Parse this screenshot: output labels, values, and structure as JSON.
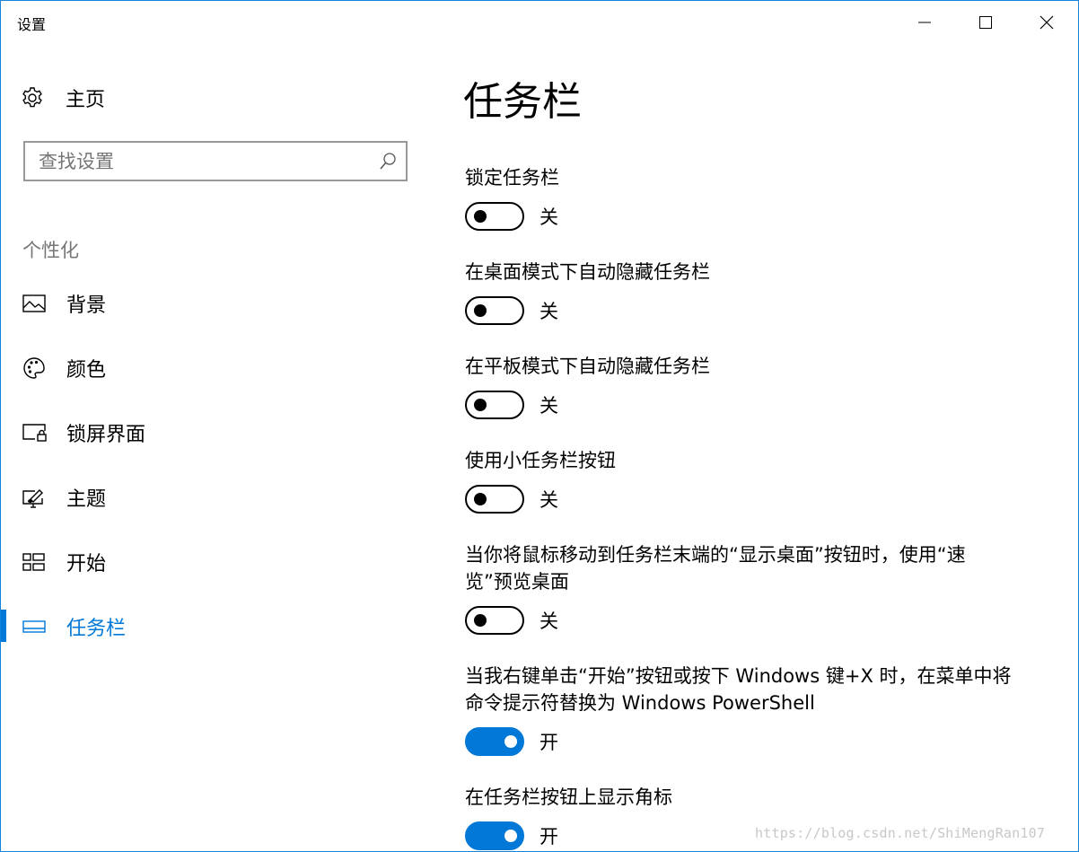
{
  "window": {
    "title": "设置"
  },
  "sidebar": {
    "home": {
      "label": "主页",
      "icon": "gear-icon"
    },
    "search": {
      "placeholder": "查找设置",
      "value": "",
      "icon": "search-icon"
    },
    "section": "个性化",
    "items": [
      {
        "label": "背景",
        "icon": "picture-icon",
        "selected": false
      },
      {
        "label": "颜色",
        "icon": "palette-icon",
        "selected": false
      },
      {
        "label": "锁屏界面",
        "icon": "lock-screen-icon",
        "selected": false
      },
      {
        "label": "主题",
        "icon": "theme-brush-icon",
        "selected": false
      },
      {
        "label": "开始",
        "icon": "start-tiles-icon",
        "selected": false
      },
      {
        "label": "任务栏",
        "icon": "taskbar-icon",
        "selected": true
      }
    ]
  },
  "main": {
    "title": "任务栏",
    "settings": [
      {
        "label": "锁定任务栏",
        "state": "关",
        "on": false
      },
      {
        "label": "在桌面模式下自动隐藏任务栏",
        "state": "关",
        "on": false
      },
      {
        "label": "在平板模式下自动隐藏任务栏",
        "state": "关",
        "on": false
      },
      {
        "label": "使用小任务栏按钮",
        "state": "关",
        "on": false
      },
      {
        "label_line1": "当你将鼠标移动到任务栏末端的“显示桌面”按钮时，使用“速",
        "label_line2": "览”预览桌面",
        "state": "关",
        "on": false
      },
      {
        "label_line1": "当我右键单击“开始”按钮或按下 Windows 键+X 时，在菜单中将",
        "label_line2": "命令提示符替换为 Windows PowerShell",
        "state": "开",
        "on": true
      },
      {
        "label": "在任务栏按钮上显示角标",
        "state": "开",
        "on": true
      }
    ]
  },
  "colors": {
    "accent": "#0078d7",
    "window_border": "#1883d7",
    "secondary_text": "#767676"
  },
  "watermark": "https://blog.csdn.net/ShiMengRan107"
}
